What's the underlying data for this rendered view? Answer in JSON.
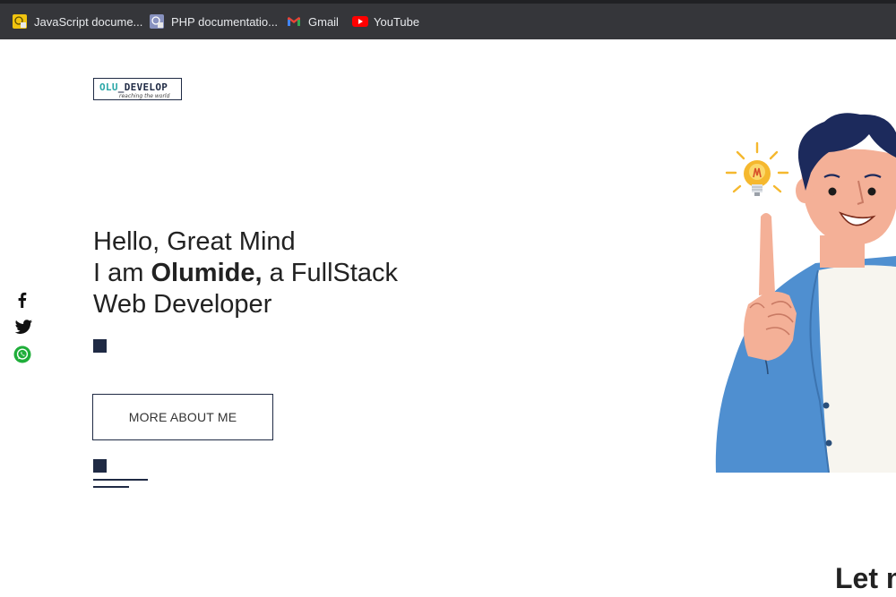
{
  "bookmarks": [
    {
      "label": "JavaScript docume...",
      "icon": "javascript-favicon-icon"
    },
    {
      "label": "PHP documentatio...",
      "icon": "php-favicon-icon"
    },
    {
      "label": "Gmail",
      "icon": "gmail-icon"
    },
    {
      "label": "YouTube",
      "icon": "youtube-icon"
    }
  ],
  "logo": {
    "part1": "OLU",
    "part2": "_DEVELOP",
    "tagline": "reaching the world"
  },
  "social": [
    "facebook-icon",
    "twitter-icon",
    "whatsapp-icon"
  ],
  "hero": {
    "line1": "Hello, Great Mind",
    "line2_prefix": "I am ",
    "line2_name": "Olumide,",
    "line2_suffix": " a FullStack",
    "line3": "Web Developer"
  },
  "cta": {
    "label": "MORE ABOUT ME"
  },
  "next_section": {
    "heading": "Let m"
  },
  "colors": {
    "navy": "#1f2a44",
    "teal": "#2aa7a7",
    "jacket": "#4f8fd0",
    "toolbar": "#35363a"
  }
}
